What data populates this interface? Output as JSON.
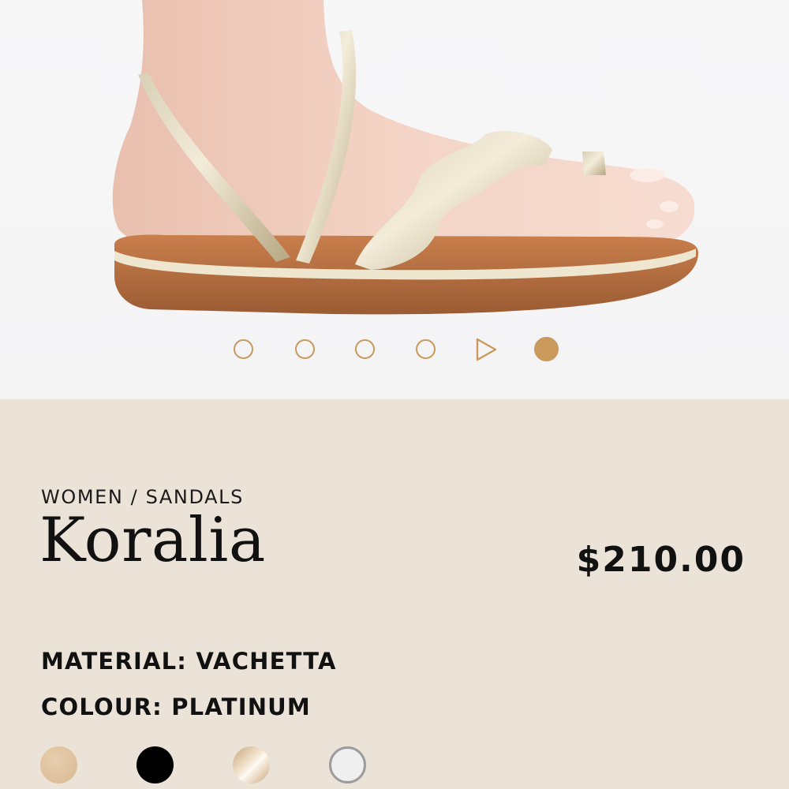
{
  "gallery": {
    "image_alt": "Foot wearing a platinum metallic sandal with scalloped toe strap and brown sole",
    "slide_count": 6,
    "active_slide": 6
  },
  "product": {
    "breadcrumb": "WOMEN / SANDALS",
    "name": "Koralia",
    "price": "$210.00",
    "material_text": "MATERIAL: VACHETTA",
    "colour_text": "COLOUR: PLATINUM"
  },
  "swatches": [
    {
      "name": "tan",
      "color": "#e2c6a2"
    },
    {
      "name": "black",
      "color": "#000000"
    },
    {
      "name": "gold-metallic",
      "color": "#e2c9a6"
    },
    {
      "name": "platinum",
      "color": "#f0f0f0"
    }
  ],
  "colors": {
    "accent": "#c99a5b",
    "info_background": "#ebe3d8"
  }
}
